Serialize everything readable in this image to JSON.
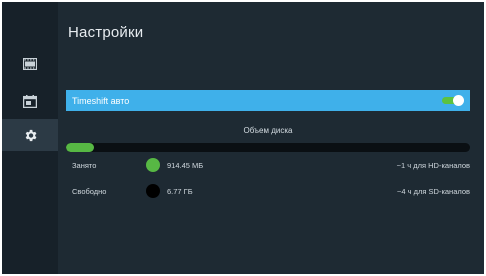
{
  "header": {
    "title": "Настройки"
  },
  "sidebar": {
    "items": [
      {
        "icon": "film-icon",
        "active": false
      },
      {
        "icon": "calendar-icon",
        "active": false
      },
      {
        "icon": "gear-icon",
        "active": true
      }
    ]
  },
  "timeshift": {
    "label": "Timeshift авто",
    "enabled": true
  },
  "disk": {
    "title": "Объем диска",
    "used_fraction": 0.07,
    "used": {
      "label": "Занято",
      "value": "914.45 МБ",
      "hint": "~1 ч для HD-каналов",
      "color": "#57b844"
    },
    "free": {
      "label": "Свободно",
      "value": "6.77 ГБ",
      "hint": "~4 ч для SD-каналов",
      "color": "#000000"
    }
  }
}
